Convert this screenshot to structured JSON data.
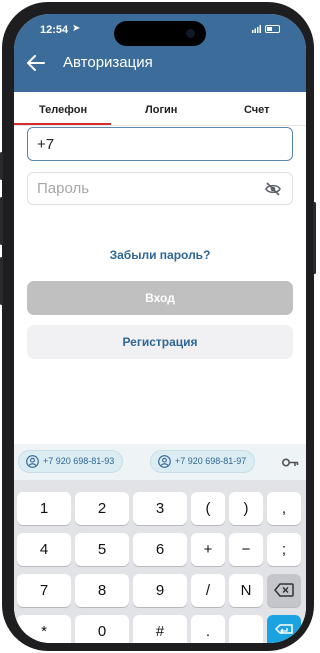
{
  "status_bar": {
    "time": "12:54"
  },
  "app_bar": {
    "title": "Авторизация"
  },
  "tabs": [
    {
      "label": "Телефон",
      "active": true
    },
    {
      "label": "Логин",
      "active": false
    },
    {
      "label": "Счет",
      "active": false
    }
  ],
  "form": {
    "phone_value": "+7",
    "password_placeholder": "Пароль",
    "forgot_label": "Забыли пароль?",
    "login_label": "Вход",
    "register_label": "Регистрация"
  },
  "keyboard": {
    "suggestions": [
      "+7 920 698-81-93",
      "+7 920 698-81-97"
    ],
    "rows": [
      [
        "1",
        "2",
        "3",
        "(",
        ")",
        ","
      ],
      [
        "4",
        "5",
        "6",
        "+",
        "−",
        ";"
      ],
      [
        "7",
        "8",
        "9",
        "/",
        "N",
        "backspace-icon"
      ],
      [
        "*",
        "0",
        "#",
        ".",
        "",
        "enter-icon"
      ]
    ]
  },
  "colors": {
    "app_bar": "#3b6c9a",
    "accent_link": "#2f6694",
    "tab_indicator": "#d32f2f",
    "login_disabled": "#c0c0c0",
    "enter_key": "#1aa3e0"
  }
}
